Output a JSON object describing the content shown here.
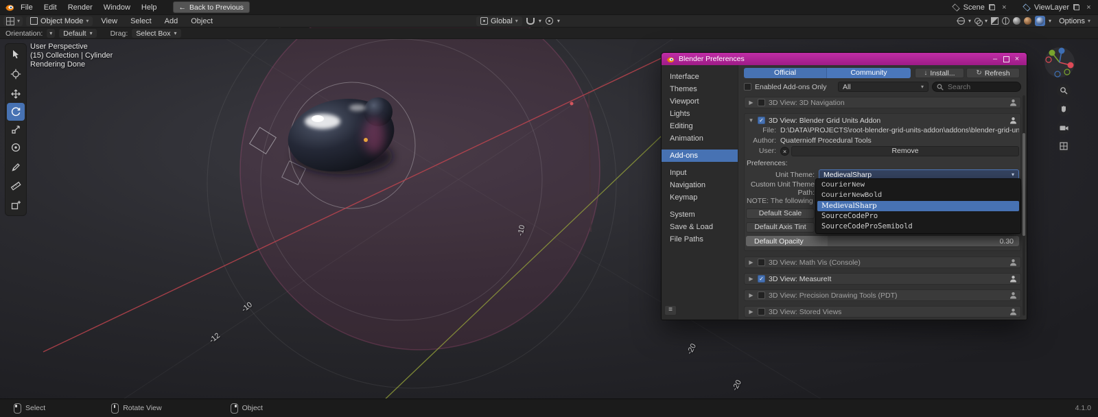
{
  "icons": {
    "dropdown": "▾",
    "collapse": "▶",
    "expand": "▼",
    "check": "✓",
    "close": "×",
    "minimize": "–",
    "download": "↓",
    "refresh": "↻",
    "menu": "≡",
    "back": "←",
    "unlink": "×"
  },
  "topbar": {
    "menus": [
      "File",
      "Edit",
      "Render",
      "Window",
      "Help"
    ],
    "back_button": "Back to Previous",
    "scene_label": "Scene",
    "viewlayer_label": "ViewLayer"
  },
  "header": {
    "mode": "Object Mode",
    "menus": [
      "View",
      "Select",
      "Add",
      "Object"
    ],
    "orientation": "Global",
    "options": "Options"
  },
  "toolsettings": {
    "orientation_label": "Orientation:",
    "orientation_value": "Default",
    "drag_label": "Drag:",
    "drag_value": "Select Box"
  },
  "viewport": {
    "info_lines": [
      "User Perspective",
      "(15) Collection | Cylinder",
      "Rendering Done"
    ],
    "axis_labels": [
      {
        "text": "-10"
      },
      {
        "text": "-10"
      },
      {
        "text": "-12"
      },
      {
        "text": "-20"
      },
      {
        "text": "-20"
      }
    ]
  },
  "statusbar": {
    "items": [
      {
        "label": "Select"
      },
      {
        "label": "Rotate View"
      },
      {
        "label": "Object"
      }
    ],
    "version": "4.1.0"
  },
  "prefs": {
    "title": "Blender Preferences",
    "sidebar": [
      {
        "label": "Interface"
      },
      {
        "label": "Themes"
      },
      {
        "label": "Viewport"
      },
      {
        "label": "Lights"
      },
      {
        "label": "Editing"
      },
      {
        "label": "Animation"
      },
      {
        "label": "Add-ons"
      },
      {
        "label": "Input"
      },
      {
        "label": "Navigation"
      },
      {
        "label": "Keymap"
      },
      {
        "label": "System"
      },
      {
        "label": "Save & Load"
      },
      {
        "label": "File Paths"
      }
    ],
    "tabs": {
      "official": "Official",
      "community": "Community"
    },
    "install_button": "Install...",
    "refresh_button": "Refresh",
    "filter": {
      "enabled_only_label": "Enabled Add-ons Only",
      "category": "All",
      "search_placeholder": "Search"
    },
    "addon_rows": [
      {
        "title": "3D View: 3D Navigation",
        "checked": false
      },
      {
        "title": "3D View: Blender Grid Units Addon",
        "checked": true
      },
      {
        "title": "3D View: Math Vis (Console)",
        "checked": false
      },
      {
        "title": "3D View: MeasureIt",
        "checked": true
      },
      {
        "title": "3D View: Precision Drawing Tools (PDT)",
        "checked": false
      },
      {
        "title": "3D View: Stored Views",
        "checked": false
      }
    ],
    "expanded": {
      "file_label": "File:",
      "file_value": "D:\\DATA\\PROJECTS\\root-blender-grid-units-addon\\addons\\blender-grid-units-addon\\__i...",
      "author_label": "Author:",
      "author_value": "Quaternioff Procedural Tools",
      "user_label": "User:",
      "remove_button": "Remove",
      "section_label": "Preferences:",
      "unit_theme_label": "Unit Theme:",
      "unit_theme_value": "MedievalSharp",
      "custom_path_label": "Custom Unit Theme Path:",
      "note_text": "NOTE: The following defaul",
      "default_scale_button": "Default Scale",
      "default_axis_tint_button": "Default Axis Tint",
      "opacity_label": "Default Opacity",
      "opacity_value": "0.30"
    },
    "font_dropdown": [
      {
        "label": "CourierNew"
      },
      {
        "label": "CourierNewBold"
      },
      {
        "label": "MedievalSharp",
        "selected": true
      },
      {
        "label": "SourceCodePro"
      },
      {
        "label": "SourceCodeProSemibold"
      }
    ]
  }
}
